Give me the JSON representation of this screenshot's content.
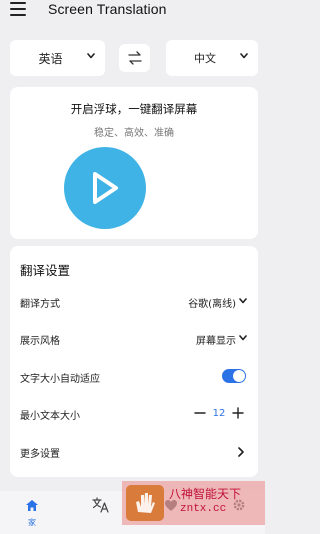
{
  "app": {
    "title": "Screen Translation"
  },
  "languages": {
    "source": "英语",
    "target": "中文"
  },
  "main": {
    "title": "开启浮球，一键翻译屏幕",
    "subtitle": "稳定、高效、准确"
  },
  "settings": {
    "title": "翻译设置",
    "rows": [
      {
        "label": "翻译方式",
        "value": "谷歌(离线)"
      },
      {
        "label": "展示风格",
        "value": "屏幕显示"
      },
      {
        "label": "文字大小自动适应",
        "toggle": true
      },
      {
        "label": "最小文本大小",
        "value": "12"
      },
      {
        "label": "更多设置"
      }
    ]
  },
  "nav": {
    "home_label": "家"
  },
  "watermark": {
    "line1": "八神智能天下",
    "line2": "zntx.cc"
  },
  "colors": {
    "accent": "#2b72e6",
    "play": "#3fb3e5",
    "background": "#efeff2"
  }
}
